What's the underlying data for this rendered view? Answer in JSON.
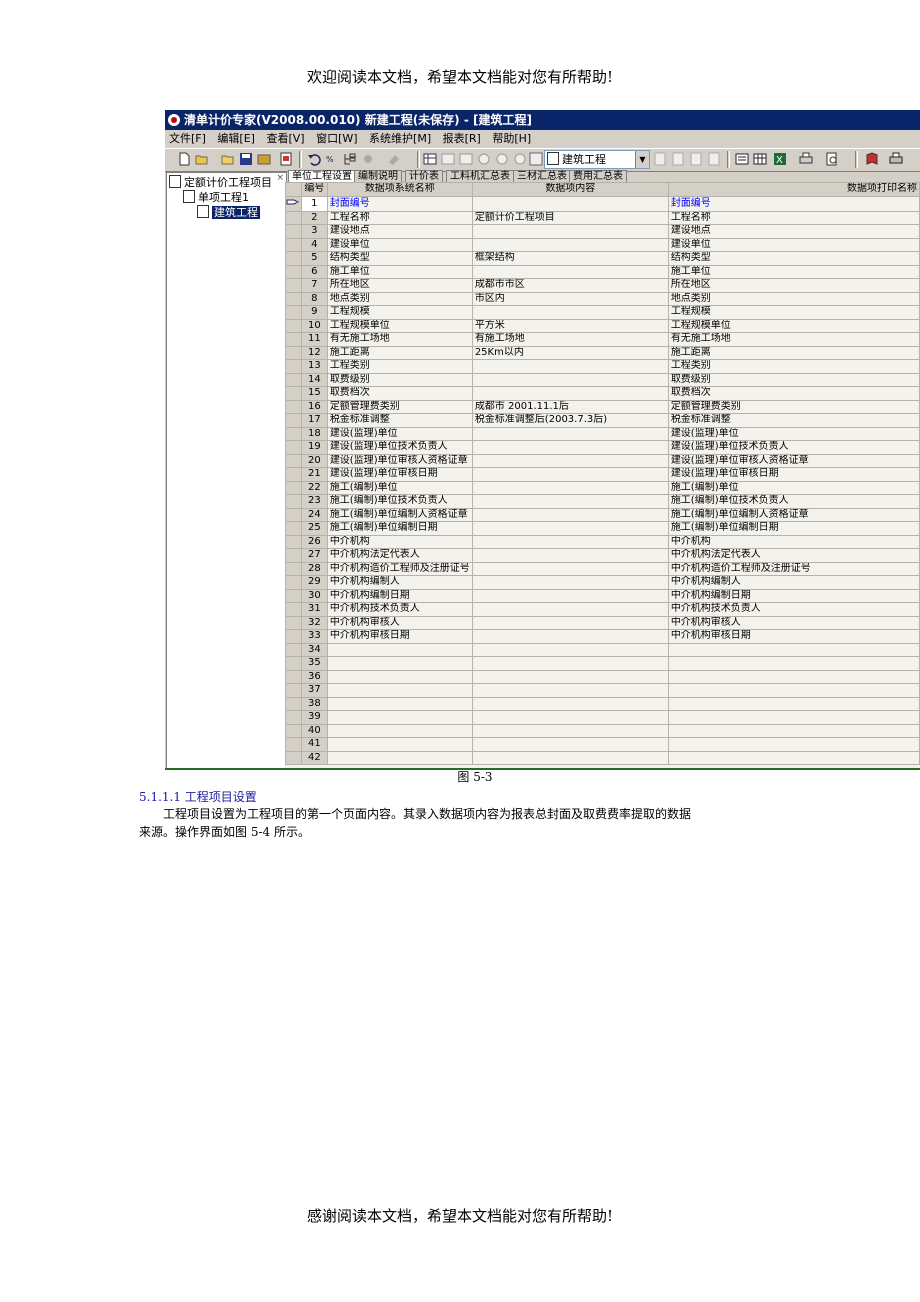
{
  "page": {
    "header": "欢迎阅读本文档，希望本文档能对您有所帮助!",
    "footer": "感谢阅读本文档，希望本文档能对您有所帮助!",
    "caption": "图 5-3",
    "heading": "5.1.1.1 工程项目设置",
    "paragraph_line1": "工程项目设置为工程项目的第一个页面内容。其录入数据项内容为报表总封面及取费费率提取的数据",
    "paragraph_line2": "来源。操作界面如图 5-4 所示。"
  },
  "window": {
    "title": "清单计价专家(V2008.00.010) 新建工程(未保存) - [建筑工程]",
    "menu": [
      "文件[F]",
      "编辑[E]",
      "查看[V]",
      "窗口[W]",
      "系统维护[M]",
      "报表[R]",
      "帮助[H]"
    ],
    "combo_value": "建筑工程",
    "tree": {
      "root": "定额计价工程项目",
      "child": "单项工程1",
      "leaf": "建筑工程"
    },
    "tabs": [
      "单位工程设置",
      "编制说明",
      "计价表",
      "工料机汇总表",
      "三材汇总表",
      "费用汇总表"
    ],
    "columns": [
      "编号",
      "数据项系统名称",
      "数据项内容",
      "数据项打印名称"
    ],
    "rows": [
      [
        "1",
        "封面编号",
        "",
        "封面编号"
      ],
      [
        "2",
        "工程名称",
        "定额计价工程项目",
        "工程名称"
      ],
      [
        "3",
        "建设地点",
        "",
        "建设地点"
      ],
      [
        "4",
        "建设单位",
        "",
        "建设单位"
      ],
      [
        "5",
        "结构类型",
        "框架结构",
        "结构类型"
      ],
      [
        "6",
        "施工单位",
        "",
        "施工单位"
      ],
      [
        "7",
        "所在地区",
        "成都市市区",
        "所在地区"
      ],
      [
        "8",
        "地点类别",
        "市区内",
        "地点类别"
      ],
      [
        "9",
        "工程规模",
        "",
        "工程规模"
      ],
      [
        "10",
        "工程规模单位",
        "平方米",
        "工程规模单位"
      ],
      [
        "11",
        "有无施工场地",
        "有施工场地",
        "有无施工场地"
      ],
      [
        "12",
        "施工距离",
        "25Km以内",
        "施工距离"
      ],
      [
        "13",
        "工程类别",
        "",
        "工程类别"
      ],
      [
        "14",
        "取费级别",
        "",
        "取费级别"
      ],
      [
        "15",
        "取费档次",
        "",
        "取费档次"
      ],
      [
        "16",
        "定额管理费类别",
        "成都市 2001.11.1后",
        "定额管理费类别"
      ],
      [
        "17",
        "税金标准调整",
        "税金标准调整后(2003.7.3后)",
        "税金标准调整"
      ],
      [
        "18",
        "建设(监理)单位",
        "",
        "建设(监理)单位"
      ],
      [
        "19",
        "建设(监理)单位技术负责人",
        "",
        "建设(监理)单位技术负责人"
      ],
      [
        "20",
        "建设(监理)单位审核人资格证章",
        "",
        "建设(监理)单位审核人资格证章"
      ],
      [
        "21",
        "建设(监理)单位审核日期",
        "",
        "建设(监理)单位审核日期"
      ],
      [
        "22",
        "施工(编制)单位",
        "",
        "施工(编制)单位"
      ],
      [
        "23",
        "施工(编制)单位技术负责人",
        "",
        "施工(编制)单位技术负责人"
      ],
      [
        "24",
        "施工(编制)单位编制人资格证章",
        "",
        "施工(编制)单位编制人资格证章"
      ],
      [
        "25",
        "施工(编制)单位编制日期",
        "",
        "施工(编制)单位编制日期"
      ],
      [
        "26",
        "中介机构",
        "",
        "中介机构"
      ],
      [
        "27",
        "中介机构法定代表人",
        "",
        "中介机构法定代表人"
      ],
      [
        "28",
        "中介机构造价工程师及注册证号",
        "",
        "中介机构造价工程师及注册证号"
      ],
      [
        "29",
        "中介机构编制人",
        "",
        "中介机构编制人"
      ],
      [
        "30",
        "中介机构编制日期",
        "",
        "中介机构编制日期"
      ],
      [
        "31",
        "中介机构技术负责人",
        "",
        "中介机构技术负责人"
      ],
      [
        "32",
        "中介机构审核人",
        "",
        "中介机构审核人"
      ],
      [
        "33",
        "中介机构审核日期",
        "",
        "中介机构审核日期"
      ],
      [
        "34",
        "",
        "",
        ""
      ],
      [
        "35",
        "",
        "",
        ""
      ],
      [
        "36",
        "",
        "",
        ""
      ],
      [
        "37",
        "",
        "",
        ""
      ],
      [
        "38",
        "",
        "",
        ""
      ],
      [
        "39",
        "",
        "",
        ""
      ],
      [
        "40",
        "",
        "",
        ""
      ],
      [
        "41",
        "",
        "",
        ""
      ],
      [
        "42",
        "",
        "",
        ""
      ]
    ]
  }
}
